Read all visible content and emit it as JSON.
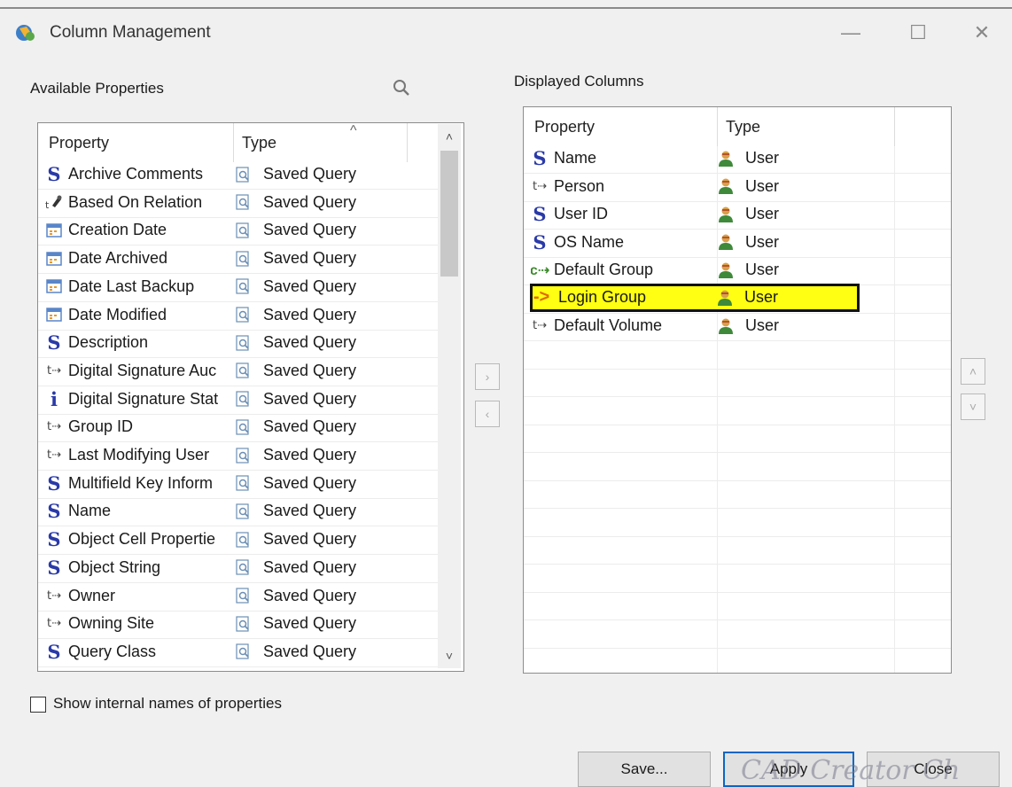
{
  "window": {
    "title": "Column Management",
    "minimize_glyph": "—",
    "maximize_glyph": "☐",
    "close_glyph": "✕"
  },
  "available": {
    "label": "Available Properties",
    "header_property": "Property",
    "header_type": "Type",
    "rows": [
      {
        "icon": "s-icon",
        "property": "Archive Comments",
        "type": "Saved Query"
      },
      {
        "icon": "relation-icon",
        "property": "Based On Relation",
        "type": "Saved Query"
      },
      {
        "icon": "date-icon",
        "property": "Creation Date",
        "type": "Saved Query"
      },
      {
        "icon": "date-icon",
        "property": "Date Archived",
        "type": "Saved Query"
      },
      {
        "icon": "date-icon",
        "property": "Date Last Backup",
        "type": "Saved Query"
      },
      {
        "icon": "date-icon",
        "property": "Date Modified",
        "type": "Saved Query"
      },
      {
        "icon": "s-icon",
        "property": "Description",
        "type": "Saved Query"
      },
      {
        "icon": "t-icon",
        "property": "Digital Signature Auc",
        "type": "Saved Query"
      },
      {
        "icon": "i-icon",
        "property": "Digital Signature Stat",
        "type": "Saved Query"
      },
      {
        "icon": "t-icon",
        "property": "Group ID",
        "type": "Saved Query"
      },
      {
        "icon": "t-icon",
        "property": "Last Modifying User",
        "type": "Saved Query"
      },
      {
        "icon": "s-icon",
        "property": "Multifield Key Inform",
        "type": "Saved Query"
      },
      {
        "icon": "s-icon",
        "property": "Name",
        "type": "Saved Query"
      },
      {
        "icon": "s-icon",
        "property": "Object Cell Propertie",
        "type": "Saved Query"
      },
      {
        "icon": "s-icon",
        "property": "Object String",
        "type": "Saved Query"
      },
      {
        "icon": "t-icon",
        "property": "Owner",
        "type": "Saved Query"
      },
      {
        "icon": "t-icon",
        "property": "Owning Site",
        "type": "Saved Query"
      },
      {
        "icon": "s-icon",
        "property": "Query Class",
        "type": "Saved Query"
      }
    ]
  },
  "displayed": {
    "label": "Displayed Columns",
    "header_property": "Property",
    "header_type": "Type",
    "rows": [
      {
        "icon": "s-icon",
        "property": "Name",
        "type": "User"
      },
      {
        "icon": "t-icon",
        "property": "Person",
        "type": "User"
      },
      {
        "icon": "s-icon",
        "property": "User ID",
        "type": "User"
      },
      {
        "icon": "s-icon",
        "property": "OS Name",
        "type": "User"
      },
      {
        "icon": "c-icon",
        "property": "Default Group",
        "type": "User"
      },
      {
        "icon": "arrow-icon",
        "property": "Login Group",
        "type": "User",
        "highlighted": true
      },
      {
        "icon": "t-icon",
        "property": "Default Volume",
        "type": "User"
      }
    ]
  },
  "glyphs": {
    "s": "S",
    "t": "t⇢",
    "i": "i",
    "arrow": "->",
    "c": "c⇢",
    "right": "›",
    "left": "‹",
    "up": "˄",
    "down": "˅",
    "caret_up": "^"
  },
  "options": {
    "show_internal_label": "Show internal names of properties",
    "show_internal_checked": false
  },
  "buttons": {
    "save": "Save...",
    "apply": "Apply",
    "close": "Close"
  },
  "watermark": "CAD Creator Ch",
  "colors": {
    "highlight": "#ffff14",
    "s_icon": "#2a3aa8",
    "user_icon": "#c98a2a",
    "apply_border": "#0b66c3"
  }
}
